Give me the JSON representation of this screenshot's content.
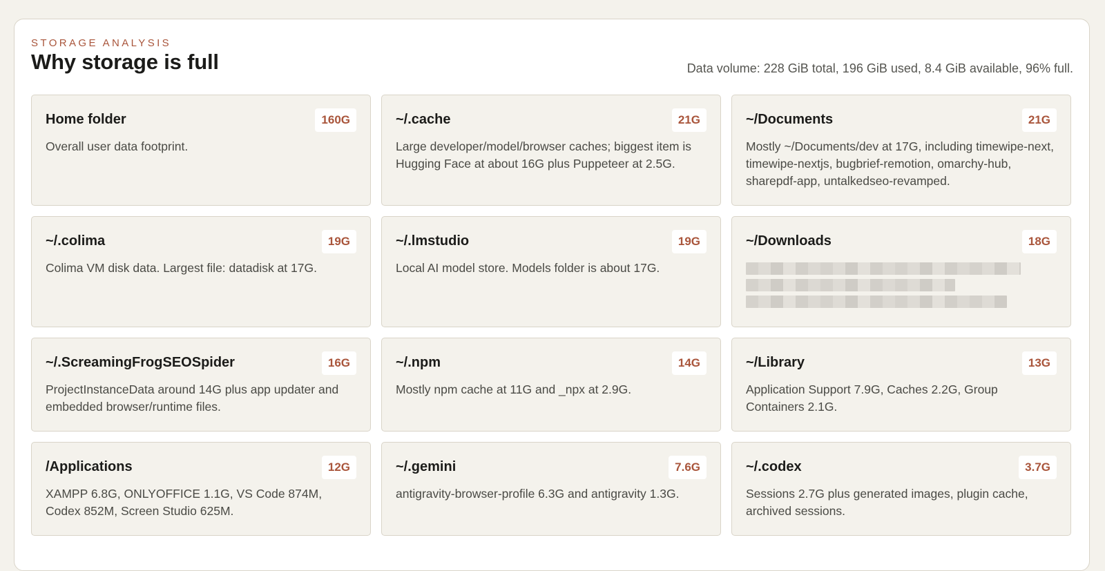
{
  "header": {
    "eyebrow": "STORAGE ANALYSIS",
    "title": "Why storage is full",
    "summary": "Data volume: 228 GiB total, 196 GiB used, 8.4 GiB available, 96% full."
  },
  "cards": [
    {
      "title": "Home folder",
      "size": "160G",
      "description": "Overall user data footprint."
    },
    {
      "title": "~/.cache",
      "size": "21G",
      "description": "Large developer/model/browser caches; biggest item is Hugging Face at about 16G plus Puppeteer at 2.5G."
    },
    {
      "title": "~/Documents",
      "size": "21G",
      "description": "Mostly ~/Documents/dev at 17G, including timewipe-next, timewipe-nextjs, bugbrief-remotion, omarchy-hub, sharepdf-app, untalkedseo-revamped."
    },
    {
      "title": "~/.colima",
      "size": "19G",
      "description": "Colima VM disk data. Largest file: datadisk at 17G."
    },
    {
      "title": "~/.lmstudio",
      "size": "19G",
      "description": "Local AI model store. Models folder is about 17G."
    },
    {
      "title": "~/Downloads",
      "size": "18G",
      "description": ""
    },
    {
      "title": "~/.ScreamingFrogSEOSpider",
      "size": "16G",
      "description": "ProjectInstanceData around 14G plus app updater and embedded browser/runtime files."
    },
    {
      "title": "~/.npm",
      "size": "14G",
      "description": "Mostly npm cache at 11G and _npx at 2.9G."
    },
    {
      "title": "~/Library",
      "size": "13G",
      "description": "Application Support 7.9G, Caches 2.2G, Group Containers 2.1G."
    },
    {
      "title": "/Applications",
      "size": "12G",
      "description": "XAMPP 6.8G, ONLYOFFICE 1.1G, VS Code 874M, Codex 852M, Screen Studio 625M."
    },
    {
      "title": "~/.gemini",
      "size": "7.6G",
      "description": "antigravity-browser-profile 6.3G and antigravity 1.3G."
    },
    {
      "title": "~/.codex",
      "size": "3.7G",
      "description": "Sessions 2.7G plus generated images, plugin cache, archived sessions."
    }
  ],
  "colors": {
    "accent": "#a9553b",
    "background": "#f4f2ec",
    "panel": "#ffffff",
    "border": "#d9d4c8"
  }
}
